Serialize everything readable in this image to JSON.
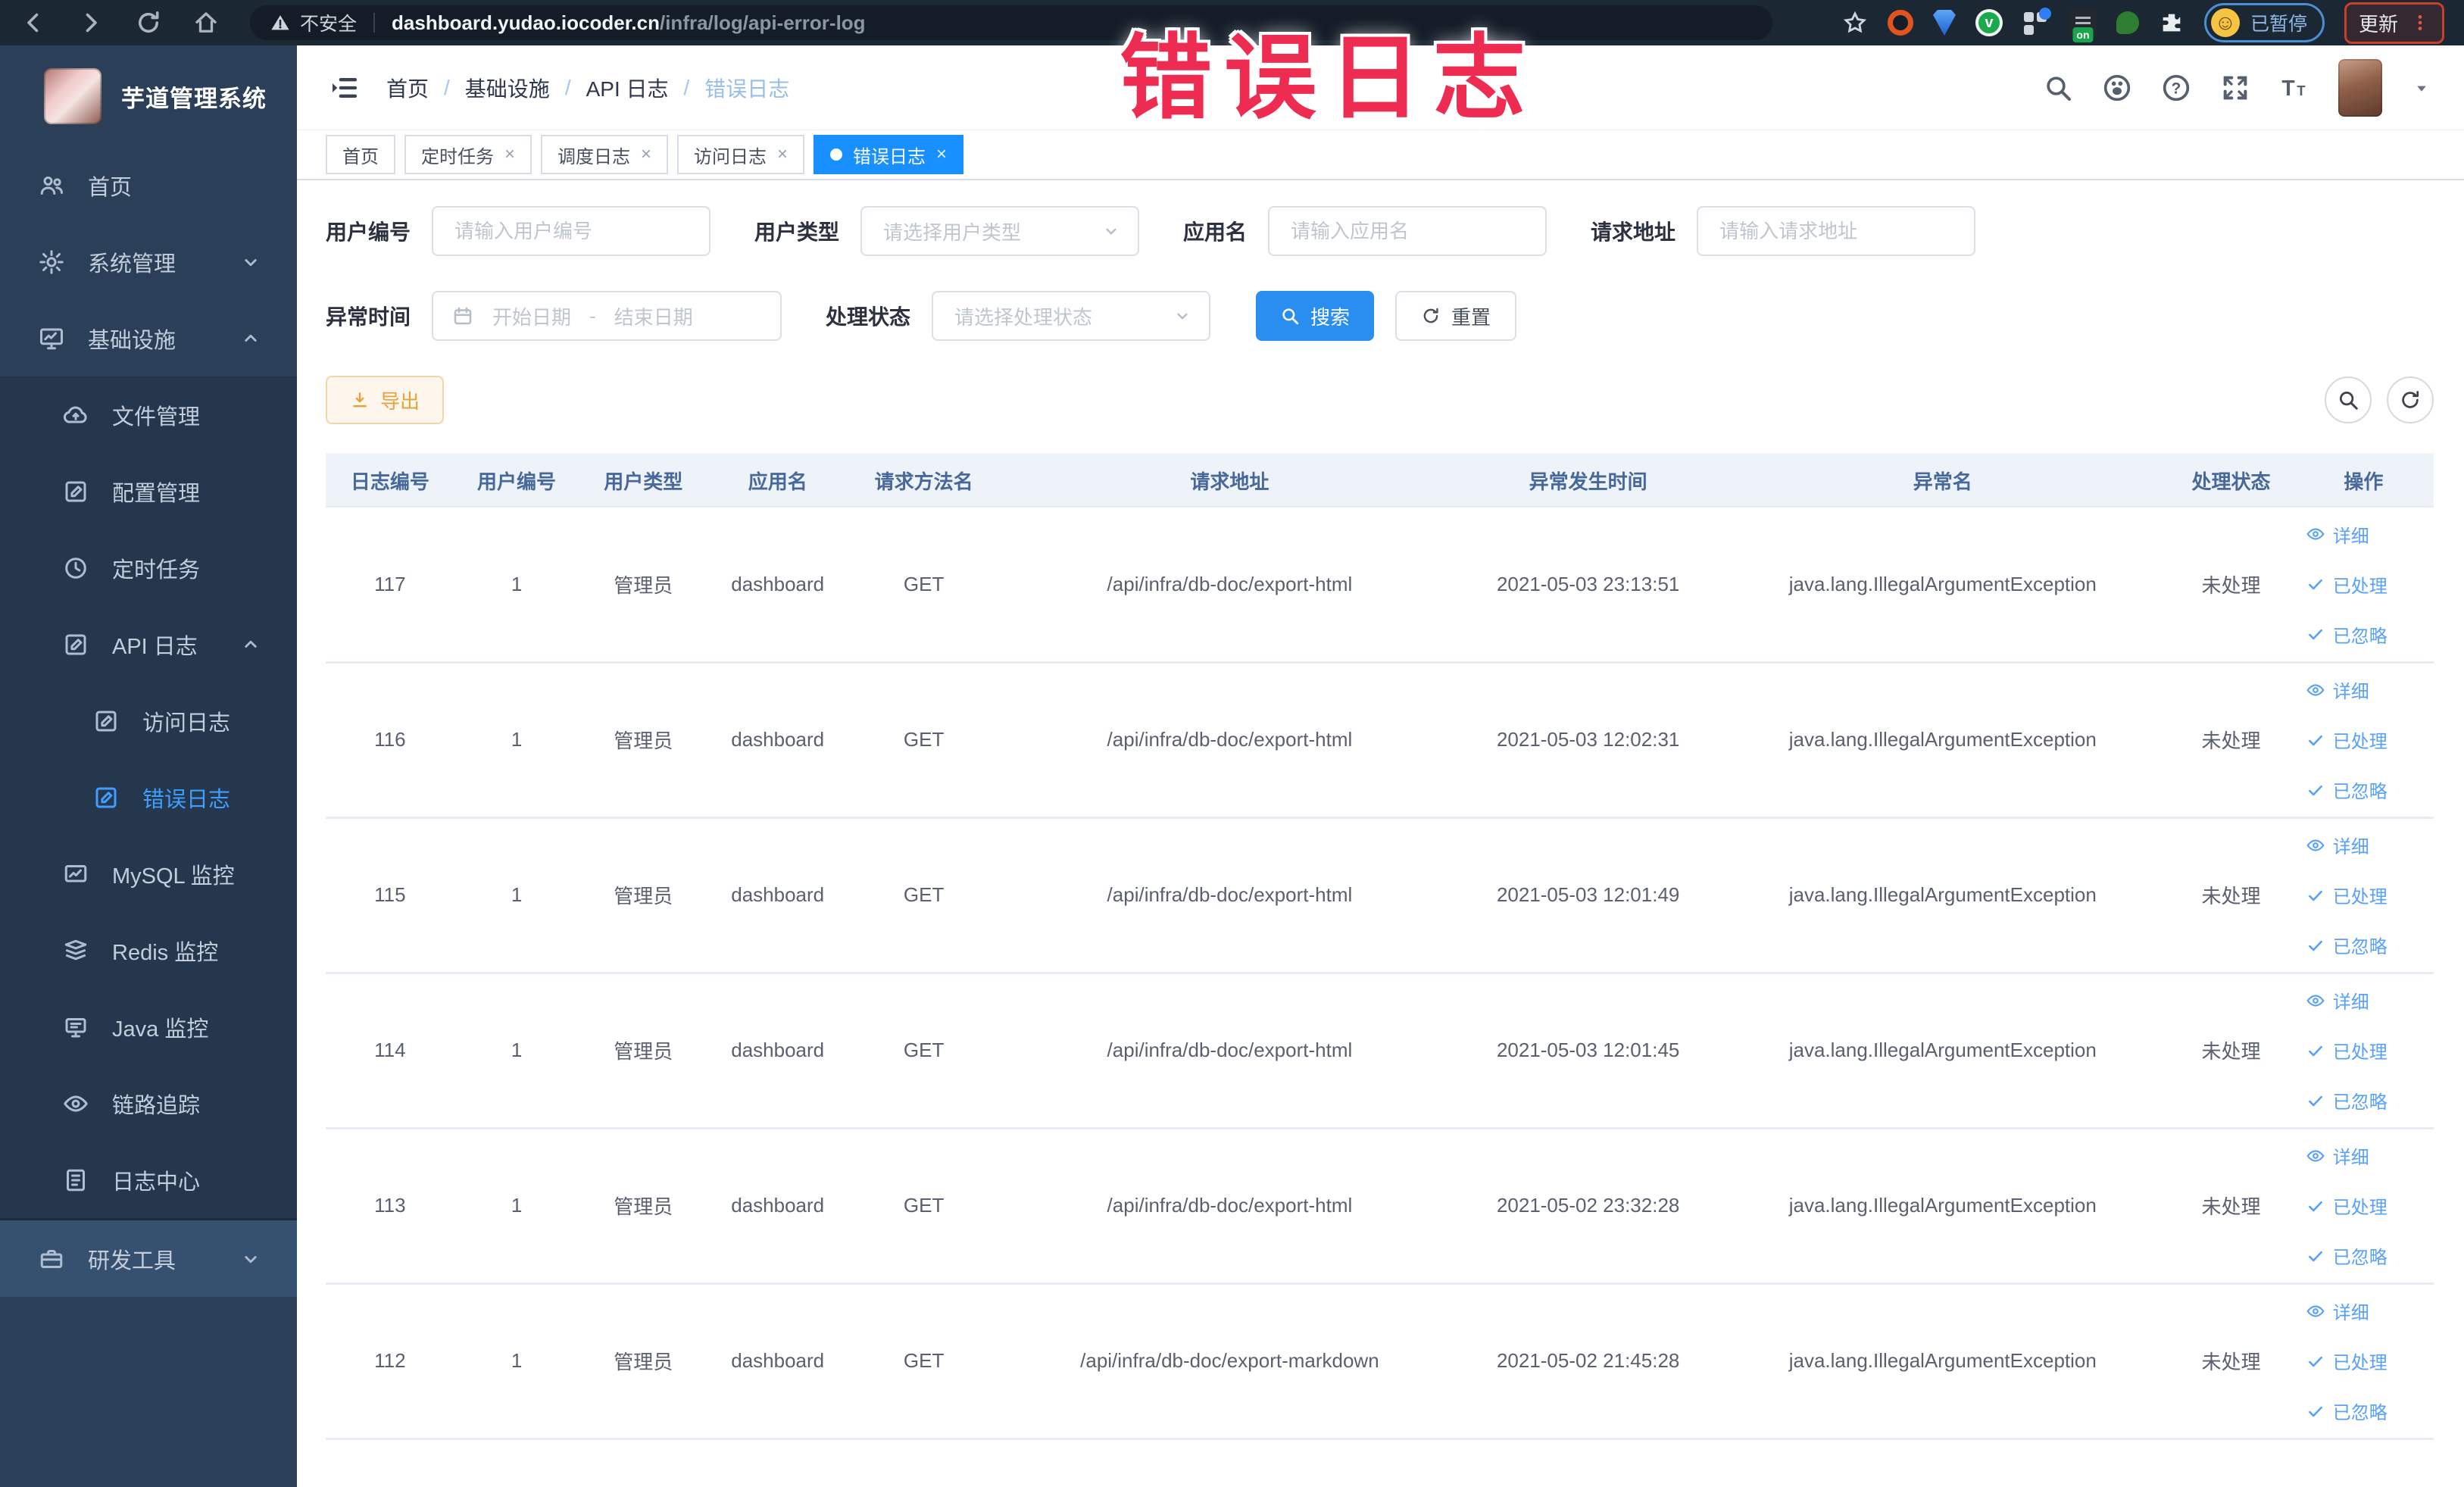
{
  "browser": {
    "security_label": "不安全",
    "url_domain": "dashboard.yudao.iocoder.cn",
    "url_path": "/infra/log/api-error-log",
    "profile_badge": "已暂停",
    "update_label": "更新"
  },
  "annotation": {
    "text": "错误日志",
    "color": "#ee2b51"
  },
  "sidebar": {
    "logo_title": "芋道管理系统",
    "items": [
      {
        "label": "首页"
      },
      {
        "label": "系统管理"
      },
      {
        "label": "基础设施"
      },
      {
        "label": "文件管理"
      },
      {
        "label": "配置管理"
      },
      {
        "label": "定时任务"
      },
      {
        "label": "API 日志"
      },
      {
        "label": "访问日志"
      },
      {
        "label": "错误日志"
      },
      {
        "label": "MySQL 监控"
      },
      {
        "label": "Redis 监控"
      },
      {
        "label": "Java 监控"
      },
      {
        "label": "链路追踪"
      },
      {
        "label": "日志中心"
      },
      {
        "label": "研发工具"
      }
    ]
  },
  "navbar": {
    "breadcrumb": [
      "首页",
      "基础设施",
      "API 日志",
      "错误日志"
    ]
  },
  "tabs": [
    {
      "label": "首页"
    },
    {
      "label": "定时任务"
    },
    {
      "label": "调度日志"
    },
    {
      "label": "访问日志"
    },
    {
      "label": "错误日志"
    }
  ],
  "filters": {
    "user_id": {
      "label": "用户编号",
      "placeholder": "请输入用户编号"
    },
    "user_type": {
      "label": "用户类型",
      "placeholder": "请选择用户类型"
    },
    "app_name": {
      "label": "应用名",
      "placeholder": "请输入应用名"
    },
    "request_url": {
      "label": "请求地址",
      "placeholder": "请输入请求地址"
    },
    "exception_time": {
      "label": "异常时间",
      "start_placeholder": "开始日期",
      "separator": "-",
      "end_placeholder": "结束日期"
    },
    "process_status": {
      "label": "处理状态",
      "placeholder": "请选择处理状态"
    },
    "search_label": "搜索",
    "reset_label": "重置"
  },
  "toolbar": {
    "export_label": "导出"
  },
  "table": {
    "columns": [
      "日志编号",
      "用户编号",
      "用户类型",
      "应用名",
      "请求方法名",
      "请求地址",
      "异常发生时间",
      "异常名",
      "处理状态",
      "操作"
    ],
    "action_labels": {
      "detail": "详细",
      "handled": "已处理",
      "ignored": "已忽略"
    },
    "rows": [
      {
        "id": "117",
        "user_id": "1",
        "user_type": "管理员",
        "app": "dashboard",
        "method": "GET",
        "url": "/api/infra/db-doc/export-html",
        "time": "2021-05-03 23:13:51",
        "exception": "java.lang.IllegalArgumentException",
        "status": "未处理"
      },
      {
        "id": "116",
        "user_id": "1",
        "user_type": "管理员",
        "app": "dashboard",
        "method": "GET",
        "url": "/api/infra/db-doc/export-html",
        "time": "2021-05-03 12:02:31",
        "exception": "java.lang.IllegalArgumentException",
        "status": "未处理"
      },
      {
        "id": "115",
        "user_id": "1",
        "user_type": "管理员",
        "app": "dashboard",
        "method": "GET",
        "url": "/api/infra/db-doc/export-html",
        "time": "2021-05-03 12:01:49",
        "exception": "java.lang.IllegalArgumentException",
        "status": "未处理"
      },
      {
        "id": "114",
        "user_id": "1",
        "user_type": "管理员",
        "app": "dashboard",
        "method": "GET",
        "url": "/api/infra/db-doc/export-html",
        "time": "2021-05-03 12:01:45",
        "exception": "java.lang.IllegalArgumentException",
        "status": "未处理"
      },
      {
        "id": "113",
        "user_id": "1",
        "user_type": "管理员",
        "app": "dashboard",
        "method": "GET",
        "url": "/api/infra/db-doc/export-html",
        "time": "2021-05-02 23:32:28",
        "exception": "java.lang.IllegalArgumentException",
        "status": "未处理"
      },
      {
        "id": "112",
        "user_id": "1",
        "user_type": "管理员",
        "app": "dashboard",
        "method": "GET",
        "url": "/api/infra/db-doc/export-markdown",
        "time": "2021-05-02 21:45:28",
        "exception": "java.lang.IllegalArgumentException",
        "status": "未处理"
      }
    ]
  },
  "colors": {
    "accent": "#1890ff",
    "link": "#58a1f8",
    "warning": "#e6a23c",
    "annotation": "#ee2b51",
    "sidebar_bg": "#2b3f58",
    "submenu_bg": "#24374d",
    "sidebar_bottom_bg": "#35516f",
    "browser_bg": "#1c2734"
  }
}
